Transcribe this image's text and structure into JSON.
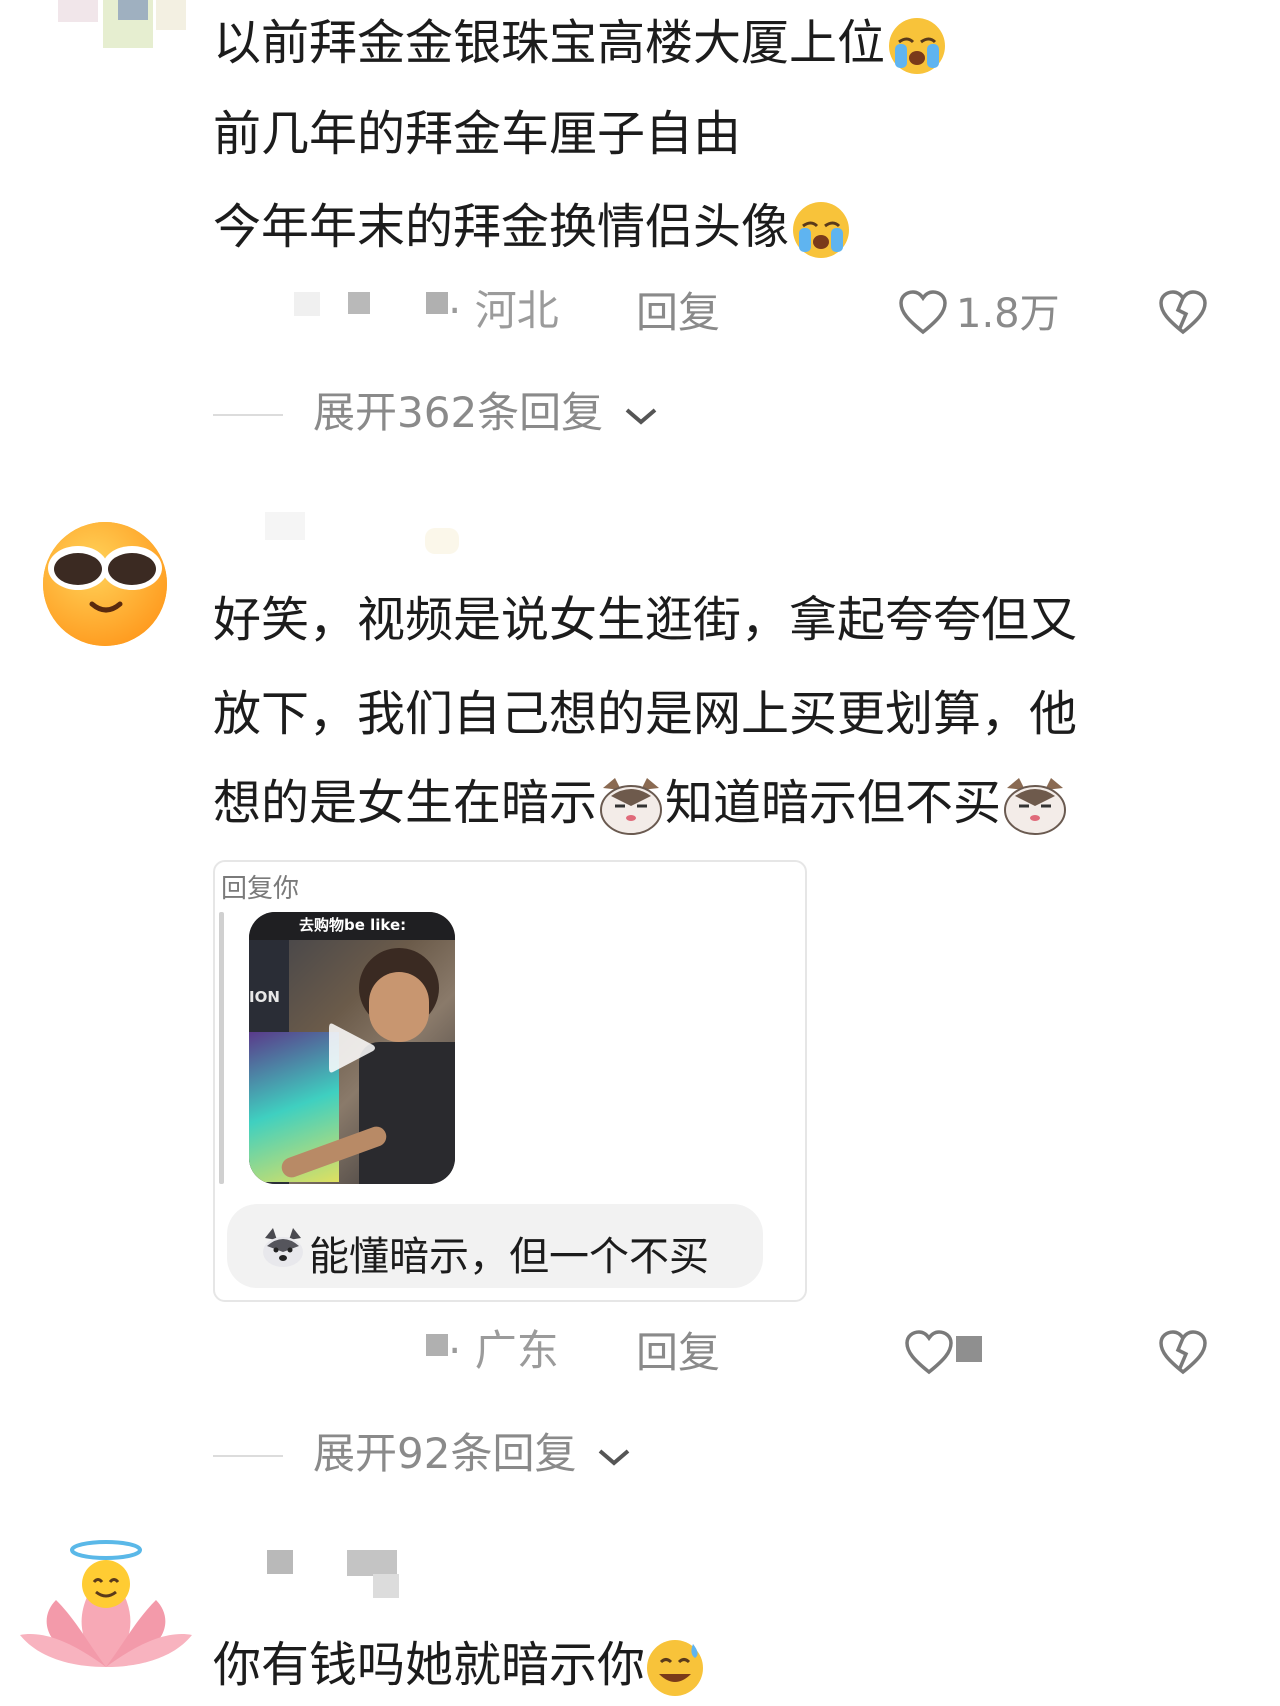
{
  "comment1": {
    "lines": [
      "以前拜金金银珠宝高楼大厦上位",
      "前几年的拜金车厘子自由",
      "今年年末的拜金换情侣头像"
    ],
    "line_emojis": [
      "crying-face-emoji",
      "",
      "crying-face-emoji"
    ],
    "location": "· 河北",
    "reply_label": "回复",
    "like_count": "1.8万",
    "expand_label": "展开362条回复"
  },
  "comment2": {
    "avatar": "sunglasses-face-avatar",
    "lines": [
      "好笑，视频是说女生逛街，拿起夸夸但又",
      "放下，我们自己想的是网上买更划算，他",
      "想的是女生在暗示",
      "知道暗示但不买"
    ],
    "quote": {
      "header": "回复你",
      "video_caption": "去购物be like:",
      "store_sign": "ION",
      "bubble_text": "能懂暗示，但一个不买"
    },
    "location": "· 广东",
    "reply_label": "回复",
    "expand_label": "展开92条回复"
  },
  "comment3": {
    "avatar": "lotus-angel-avatar",
    "line": "你有钱吗她就暗示你"
  },
  "colors": {
    "text": "#1c1c1c",
    "meta": "#9b9b9b",
    "divider": "#dcdcdc"
  }
}
